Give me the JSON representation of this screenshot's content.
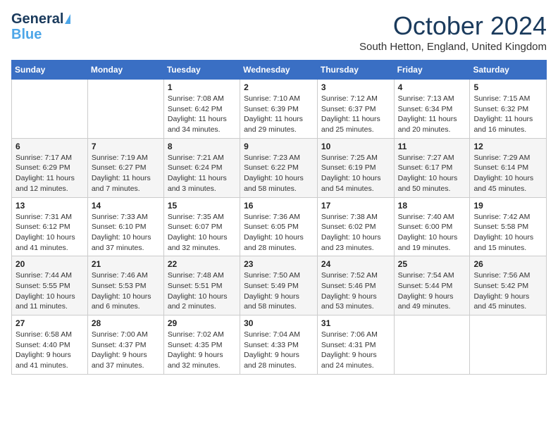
{
  "logo": {
    "line1": "General",
    "line2": "Blue"
  },
  "title": "October 2024",
  "location": "South Hetton, England, United Kingdom",
  "days_header": [
    "Sunday",
    "Monday",
    "Tuesday",
    "Wednesday",
    "Thursday",
    "Friday",
    "Saturday"
  ],
  "weeks": [
    [
      {
        "num": "",
        "info": ""
      },
      {
        "num": "",
        "info": ""
      },
      {
        "num": "1",
        "info": "Sunrise: 7:08 AM\nSunset: 6:42 PM\nDaylight: 11 hours and 34 minutes."
      },
      {
        "num": "2",
        "info": "Sunrise: 7:10 AM\nSunset: 6:39 PM\nDaylight: 11 hours and 29 minutes."
      },
      {
        "num": "3",
        "info": "Sunrise: 7:12 AM\nSunset: 6:37 PM\nDaylight: 11 hours and 25 minutes."
      },
      {
        "num": "4",
        "info": "Sunrise: 7:13 AM\nSunset: 6:34 PM\nDaylight: 11 hours and 20 minutes."
      },
      {
        "num": "5",
        "info": "Sunrise: 7:15 AM\nSunset: 6:32 PM\nDaylight: 11 hours and 16 minutes."
      }
    ],
    [
      {
        "num": "6",
        "info": "Sunrise: 7:17 AM\nSunset: 6:29 PM\nDaylight: 11 hours and 12 minutes."
      },
      {
        "num": "7",
        "info": "Sunrise: 7:19 AM\nSunset: 6:27 PM\nDaylight: 11 hours and 7 minutes."
      },
      {
        "num": "8",
        "info": "Sunrise: 7:21 AM\nSunset: 6:24 PM\nDaylight: 11 hours and 3 minutes."
      },
      {
        "num": "9",
        "info": "Sunrise: 7:23 AM\nSunset: 6:22 PM\nDaylight: 10 hours and 58 minutes."
      },
      {
        "num": "10",
        "info": "Sunrise: 7:25 AM\nSunset: 6:19 PM\nDaylight: 10 hours and 54 minutes."
      },
      {
        "num": "11",
        "info": "Sunrise: 7:27 AM\nSunset: 6:17 PM\nDaylight: 10 hours and 50 minutes."
      },
      {
        "num": "12",
        "info": "Sunrise: 7:29 AM\nSunset: 6:14 PM\nDaylight: 10 hours and 45 minutes."
      }
    ],
    [
      {
        "num": "13",
        "info": "Sunrise: 7:31 AM\nSunset: 6:12 PM\nDaylight: 10 hours and 41 minutes."
      },
      {
        "num": "14",
        "info": "Sunrise: 7:33 AM\nSunset: 6:10 PM\nDaylight: 10 hours and 37 minutes."
      },
      {
        "num": "15",
        "info": "Sunrise: 7:35 AM\nSunset: 6:07 PM\nDaylight: 10 hours and 32 minutes."
      },
      {
        "num": "16",
        "info": "Sunrise: 7:36 AM\nSunset: 6:05 PM\nDaylight: 10 hours and 28 minutes."
      },
      {
        "num": "17",
        "info": "Sunrise: 7:38 AM\nSunset: 6:02 PM\nDaylight: 10 hours and 23 minutes."
      },
      {
        "num": "18",
        "info": "Sunrise: 7:40 AM\nSunset: 6:00 PM\nDaylight: 10 hours and 19 minutes."
      },
      {
        "num": "19",
        "info": "Sunrise: 7:42 AM\nSunset: 5:58 PM\nDaylight: 10 hours and 15 minutes."
      }
    ],
    [
      {
        "num": "20",
        "info": "Sunrise: 7:44 AM\nSunset: 5:55 PM\nDaylight: 10 hours and 11 minutes."
      },
      {
        "num": "21",
        "info": "Sunrise: 7:46 AM\nSunset: 5:53 PM\nDaylight: 10 hours and 6 minutes."
      },
      {
        "num": "22",
        "info": "Sunrise: 7:48 AM\nSunset: 5:51 PM\nDaylight: 10 hours and 2 minutes."
      },
      {
        "num": "23",
        "info": "Sunrise: 7:50 AM\nSunset: 5:49 PM\nDaylight: 9 hours and 58 minutes."
      },
      {
        "num": "24",
        "info": "Sunrise: 7:52 AM\nSunset: 5:46 PM\nDaylight: 9 hours and 53 minutes."
      },
      {
        "num": "25",
        "info": "Sunrise: 7:54 AM\nSunset: 5:44 PM\nDaylight: 9 hours and 49 minutes."
      },
      {
        "num": "26",
        "info": "Sunrise: 7:56 AM\nSunset: 5:42 PM\nDaylight: 9 hours and 45 minutes."
      }
    ],
    [
      {
        "num": "27",
        "info": "Sunrise: 6:58 AM\nSunset: 4:40 PM\nDaylight: 9 hours and 41 minutes."
      },
      {
        "num": "28",
        "info": "Sunrise: 7:00 AM\nSunset: 4:37 PM\nDaylight: 9 hours and 37 minutes."
      },
      {
        "num": "29",
        "info": "Sunrise: 7:02 AM\nSunset: 4:35 PM\nDaylight: 9 hours and 32 minutes."
      },
      {
        "num": "30",
        "info": "Sunrise: 7:04 AM\nSunset: 4:33 PM\nDaylight: 9 hours and 28 minutes."
      },
      {
        "num": "31",
        "info": "Sunrise: 7:06 AM\nSunset: 4:31 PM\nDaylight: 9 hours and 24 minutes."
      },
      {
        "num": "",
        "info": ""
      },
      {
        "num": "",
        "info": ""
      }
    ]
  ]
}
